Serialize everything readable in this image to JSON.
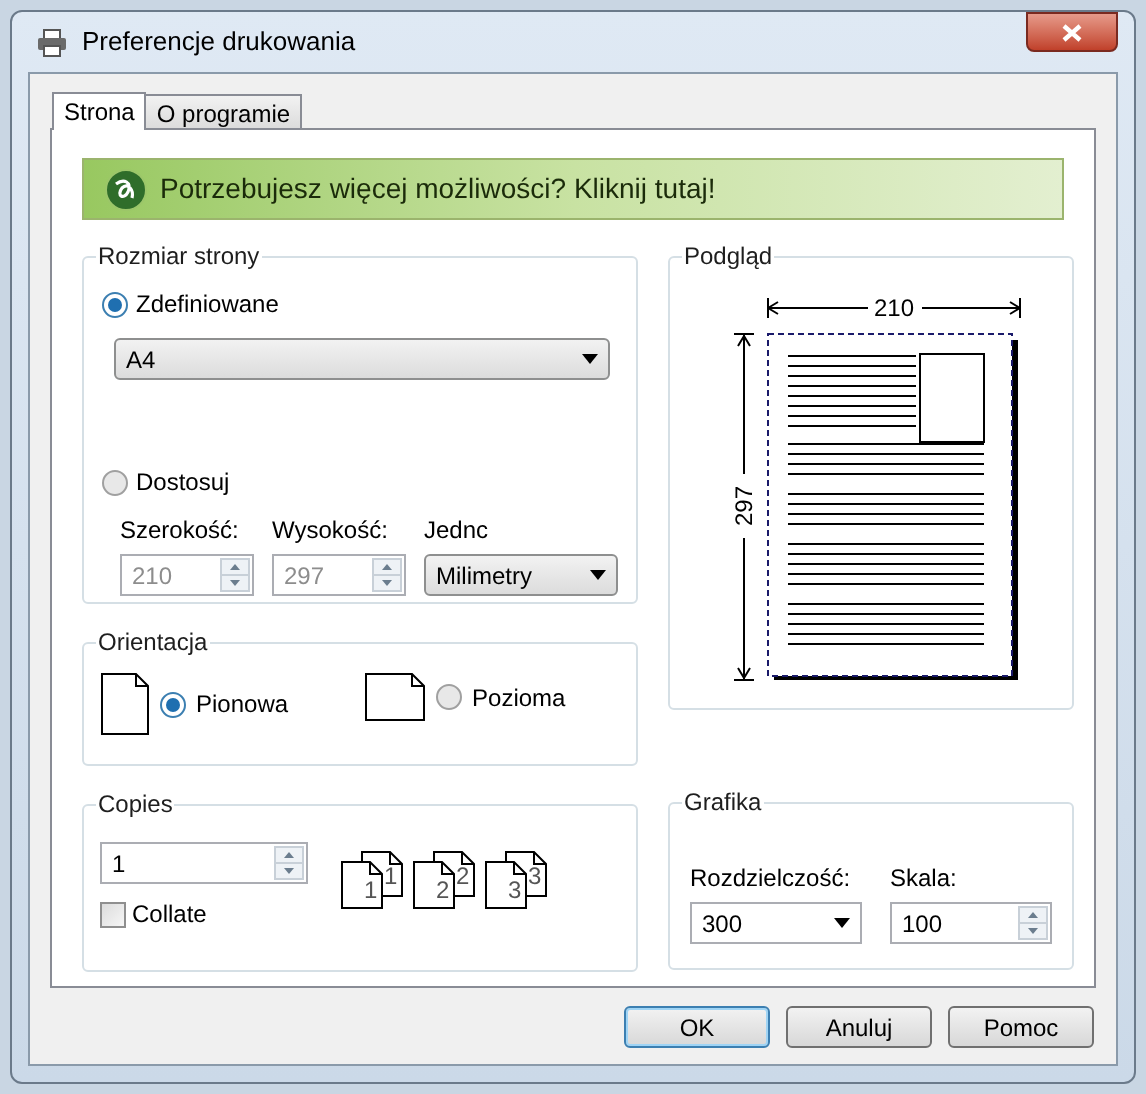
{
  "window": {
    "title": "Preferencje drukowania"
  },
  "tabs": [
    {
      "label": "Strona",
      "selected": true
    },
    {
      "label": "O programie",
      "selected": false
    }
  ],
  "banner": {
    "text": "Potrzebujesz więcej możliwości? Kliknij tutaj!"
  },
  "page_size": {
    "title": "Rozmiar strony",
    "options": [
      {
        "label": "Zdefiniowane",
        "selected": true
      },
      {
        "label": "Dostosuj",
        "selected": false
      }
    ],
    "paper": "A4",
    "width": {
      "label": "Szerokość:",
      "value": "210",
      "disabled": true
    },
    "height": {
      "label": "Wysokość:",
      "value": "297",
      "disabled": true
    },
    "units": {
      "label": "Jednc",
      "value": "Milimetry"
    }
  },
  "orientation": {
    "title": "Orientacja",
    "options": [
      {
        "label": "Pionowa",
        "selected": true,
        "kind": "portrait"
      },
      {
        "label": "Pozioma",
        "selected": false,
        "kind": "landscape"
      }
    ]
  },
  "copies": {
    "title": "Copies",
    "value": "1",
    "collate": {
      "label": "Collate",
      "checked": false
    },
    "stacks": [
      {
        "front": "1",
        "back": "1"
      },
      {
        "front": "2",
        "back": "2"
      },
      {
        "front": "3",
        "back": "3"
      }
    ]
  },
  "preview": {
    "title": "Podgląd",
    "width_label": "210",
    "height_label": "297"
  },
  "graphics": {
    "title": "Grafika",
    "resolution": {
      "label": "Rozdzielczość:",
      "value": "300"
    },
    "scale": {
      "label": "Skala:",
      "value": "100"
    }
  },
  "buttons": [
    {
      "label": "OK",
      "default": true
    },
    {
      "label": "Anuluj",
      "default": false
    },
    {
      "label": "Pomoc",
      "default": false
    }
  ]
}
